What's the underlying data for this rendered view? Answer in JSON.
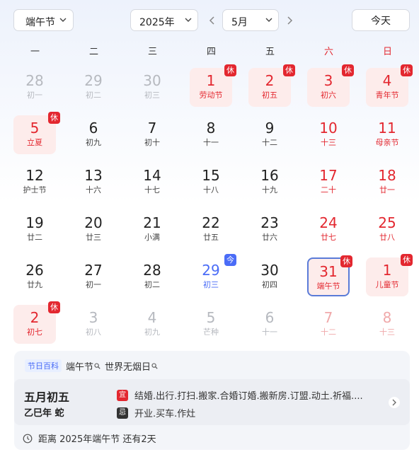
{
  "toolbar": {
    "holiday_select": "端午节",
    "year_select": "2025年",
    "month_select": "5月",
    "today_label": "今天"
  },
  "weekdays": [
    "一",
    "二",
    "三",
    "四",
    "五",
    "六",
    "日"
  ],
  "weekend_color": "#e3272f",
  "accent_color": "#4a6cf7",
  "days": [
    {
      "n": "28",
      "s": "初一",
      "muted": true
    },
    {
      "n": "29",
      "s": "初二",
      "muted": true
    },
    {
      "n": "30",
      "s": "初三",
      "muted": true
    },
    {
      "n": "1",
      "s": "劳动节",
      "hol": true,
      "badge": "休",
      "red": true
    },
    {
      "n": "2",
      "s": "初五",
      "hol": true,
      "badge": "休",
      "red": true
    },
    {
      "n": "3",
      "s": "初六",
      "hol": true,
      "badge": "休",
      "red": true
    },
    {
      "n": "4",
      "s": "青年节",
      "hol": true,
      "badge": "休",
      "red": true
    },
    {
      "n": "5",
      "s": "立夏",
      "hol": true,
      "badge": "休",
      "red": true
    },
    {
      "n": "6",
      "s": "初九"
    },
    {
      "n": "7",
      "s": "初十"
    },
    {
      "n": "8",
      "s": "十一"
    },
    {
      "n": "9",
      "s": "十二"
    },
    {
      "n": "10",
      "s": "十三",
      "red": true
    },
    {
      "n": "11",
      "s": "母亲节",
      "red": true
    },
    {
      "n": "12",
      "s": "护士节"
    },
    {
      "n": "13",
      "s": "十六"
    },
    {
      "n": "14",
      "s": "十七"
    },
    {
      "n": "15",
      "s": "十八"
    },
    {
      "n": "16",
      "s": "十九"
    },
    {
      "n": "17",
      "s": "二十",
      "red": true
    },
    {
      "n": "18",
      "s": "廿一",
      "red": true
    },
    {
      "n": "19",
      "s": "廿二"
    },
    {
      "n": "20",
      "s": "廿三"
    },
    {
      "n": "21",
      "s": "小满"
    },
    {
      "n": "22",
      "s": "廿五"
    },
    {
      "n": "23",
      "s": "廿六"
    },
    {
      "n": "24",
      "s": "廿七",
      "red": true
    },
    {
      "n": "25",
      "s": "廿八",
      "red": true
    },
    {
      "n": "26",
      "s": "廿九"
    },
    {
      "n": "27",
      "s": "初一"
    },
    {
      "n": "28",
      "s": "初二"
    },
    {
      "n": "29",
      "s": "初三",
      "today": true,
      "badge": "今"
    },
    {
      "n": "30",
      "s": "初四"
    },
    {
      "n": "31",
      "s": "端午节",
      "selected": true,
      "badge": "休",
      "red": true
    },
    {
      "n": "1",
      "s": "儿童节",
      "hol": true,
      "badge": "休",
      "red": true
    },
    {
      "n": "2",
      "s": "初七",
      "hol": true,
      "badge": "休",
      "red": true
    },
    {
      "n": "3",
      "s": "初八",
      "muted": true
    },
    {
      "n": "4",
      "s": "初九",
      "muted": true
    },
    {
      "n": "5",
      "s": "芒种",
      "muted": true
    },
    {
      "n": "6",
      "s": "十一",
      "muted": true
    },
    {
      "n": "7",
      "s": "十二",
      "muted": true,
      "red": true
    },
    {
      "n": "8",
      "s": "十三",
      "muted": true,
      "red": true
    }
  ],
  "info": {
    "tag": "节日百科",
    "links": [
      "端午节",
      "世界无烟日"
    ],
    "lunar_date": "五月初五",
    "lunar_year": "乙巳年 蛇",
    "yi_label": "宜",
    "yi_text": "结婚.出行.打扫.搬家.合婚订婚.搬新房.订盟.动土.祈福....",
    "ji_label": "忌",
    "ji_text": "开业.买车.作灶",
    "countdown": "距离 2025年端午节 还有2天"
  }
}
